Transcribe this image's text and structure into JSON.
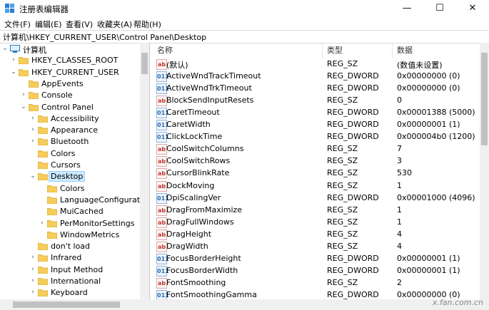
{
  "window": {
    "title": "注册表编辑器",
    "minimize": "—",
    "maximize": "☐",
    "close": "✕"
  },
  "menu": [
    "文件(F)",
    "编辑(E)",
    "查看(V)",
    "收藏夹(A)",
    "帮助(H)"
  ],
  "address": "计算机\\HKEY_CURRENT_USER\\Control Panel\\Desktop",
  "tree": [
    {
      "label": "计算机",
      "expanded": true
    },
    {
      "label": "HKEY_CLASSES_ROOT",
      "expanded": false
    },
    {
      "label": "HKEY_CURRENT_USER",
      "expanded": true
    },
    {
      "label": "AppEvents",
      "expanded": false
    },
    {
      "label": "Console",
      "expanded": false
    },
    {
      "label": "Control Panel",
      "expanded": true
    },
    {
      "label": "Accessibility",
      "expanded": false
    },
    {
      "label": "Appearance",
      "expanded": false
    },
    {
      "label": "Bluetooth",
      "expanded": false
    },
    {
      "label": "Colors",
      "expanded": false
    },
    {
      "label": "Cursors",
      "expanded": false
    },
    {
      "label": "Desktop",
      "expanded": true
    },
    {
      "label": "Colors",
      "expanded": false
    },
    {
      "label": "LanguageConfiguratio",
      "expanded": false
    },
    {
      "label": "MuiCached",
      "expanded": false
    },
    {
      "label": "PerMonitorSettings",
      "expanded": false
    },
    {
      "label": "WindowMetrics",
      "expanded": false
    },
    {
      "label": "don't load",
      "expanded": false
    },
    {
      "label": "Infrared",
      "expanded": false
    },
    {
      "label": "Input Method",
      "expanded": false
    },
    {
      "label": "International",
      "expanded": false
    },
    {
      "label": "Keyboard",
      "expanded": false
    }
  ],
  "columns": {
    "name": "名称",
    "type": "类型",
    "data": "数据"
  },
  "values": [
    {
      "name": "(默认)",
      "type": "REG_SZ",
      "data": "(数值未设置)",
      "kind": "sz"
    },
    {
      "name": "ActiveWndTrackTimeout",
      "type": "REG_DWORD",
      "data": "0x00000000 (0)",
      "kind": "dw"
    },
    {
      "name": "ActiveWndTrkTimeout",
      "type": "REG_DWORD",
      "data": "0x00000000 (0)",
      "kind": "dw"
    },
    {
      "name": "BlockSendInputResets",
      "type": "REG_SZ",
      "data": "0",
      "kind": "sz"
    },
    {
      "name": "CaretTimeout",
      "type": "REG_DWORD",
      "data": "0x00001388 (5000)",
      "kind": "dw"
    },
    {
      "name": "CaretWidth",
      "type": "REG_DWORD",
      "data": "0x00000001 (1)",
      "kind": "dw"
    },
    {
      "name": "ClickLockTime",
      "type": "REG_DWORD",
      "data": "0x000004b0 (1200)",
      "kind": "dw"
    },
    {
      "name": "CoolSwitchColumns",
      "type": "REG_SZ",
      "data": "7",
      "kind": "sz"
    },
    {
      "name": "CoolSwitchRows",
      "type": "REG_SZ",
      "data": "3",
      "kind": "sz"
    },
    {
      "name": "CursorBlinkRate",
      "type": "REG_SZ",
      "data": "530",
      "kind": "sz"
    },
    {
      "name": "DockMoving",
      "type": "REG_SZ",
      "data": "1",
      "kind": "sz"
    },
    {
      "name": "DpiScalingVer",
      "type": "REG_DWORD",
      "data": "0x00001000 (4096)",
      "kind": "dw"
    },
    {
      "name": "DragFromMaximize",
      "type": "REG_SZ",
      "data": "1",
      "kind": "sz"
    },
    {
      "name": "DragFullWindows",
      "type": "REG_SZ",
      "data": "1",
      "kind": "sz"
    },
    {
      "name": "DragHeight",
      "type": "REG_SZ",
      "data": "4",
      "kind": "sz"
    },
    {
      "name": "DragWidth",
      "type": "REG_SZ",
      "data": "4",
      "kind": "sz"
    },
    {
      "name": "FocusBorderHeight",
      "type": "REG_DWORD",
      "data": "0x00000001 (1)",
      "kind": "dw"
    },
    {
      "name": "FocusBorderWidth",
      "type": "REG_DWORD",
      "data": "0x00000001 (1)",
      "kind": "dw"
    },
    {
      "name": "FontSmoothing",
      "type": "REG_SZ",
      "data": "2",
      "kind": "sz"
    },
    {
      "name": "FontSmoothingGamma",
      "type": "REG_DWORD",
      "data": "0x00000000 (0)",
      "kind": "dw"
    }
  ],
  "icons": {
    "sz": "ab",
    "dw": "011"
  },
  "watermark": "x.fan.com.cn"
}
